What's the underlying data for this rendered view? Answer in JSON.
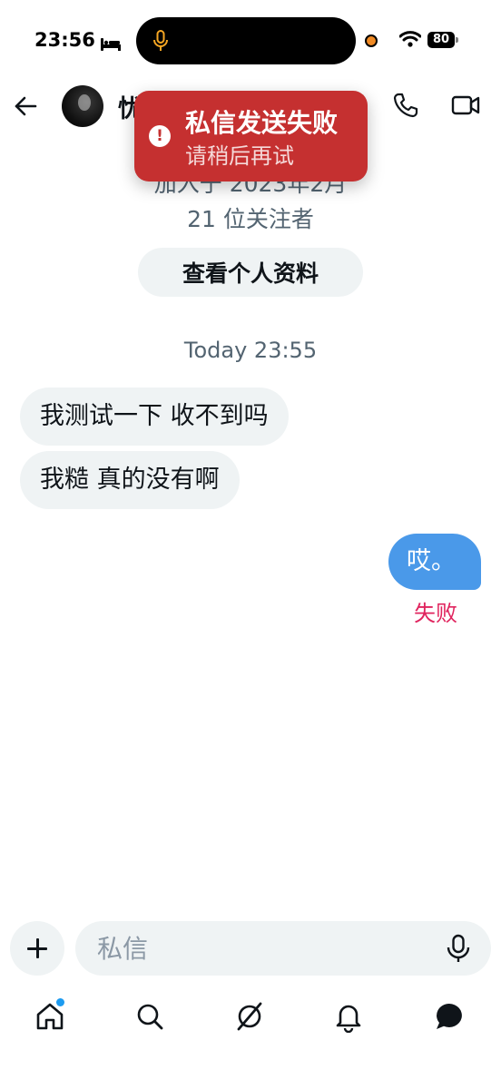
{
  "status_bar": {
    "time": "23:56",
    "battery": "80",
    "icons": [
      "bed-icon",
      "microphone-icon",
      "orange-dot-indicator",
      "wifi-icon",
      "battery-icon"
    ]
  },
  "header": {
    "name": "忧",
    "icons": [
      "back-arrow-icon",
      "phone-icon",
      "video-icon"
    ]
  },
  "toast": {
    "title": "私信发送失败",
    "subtitle": "请稍后再试",
    "icon": "alert-icon",
    "color": "#c53030"
  },
  "profile": {
    "joined": "加入于 2023年2月",
    "followers": "21 位关注者",
    "view_profile_label": "查看个人资料"
  },
  "conversation": {
    "timestamp": "Today 23:55",
    "messages": [
      {
        "direction": "in",
        "text": "我测试一下 收不到吗"
      },
      {
        "direction": "in",
        "text": "我糙 真的没有啊"
      },
      {
        "direction": "out",
        "text": "哎。",
        "status": "失败"
      }
    ]
  },
  "composer": {
    "placeholder": "私信",
    "icons": [
      "plus-icon",
      "voice-mic-icon"
    ]
  },
  "tabbar": {
    "items": [
      "home",
      "search",
      "grok",
      "notifications",
      "messages"
    ]
  },
  "colors": {
    "accent": "#1d9bf0",
    "outgoing_bubble": "#4a99e9",
    "incoming_bubble": "#eff3f4",
    "failed_text": "#e0245e",
    "toast_bg": "#c53030"
  }
}
